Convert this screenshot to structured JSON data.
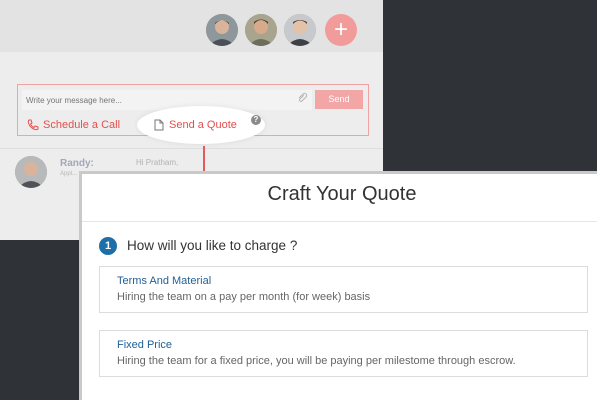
{
  "chat": {
    "message_placeholder": "Write your message here...",
    "send_label": "Send",
    "actions": {
      "schedule_label": "Schedule a Call",
      "quote_label": "Send a Quote",
      "help_label": "?"
    },
    "add_label": "+",
    "last_message": {
      "sender": "Randy:",
      "sub": "Appl...",
      "text": "Hi Pratham,"
    }
  },
  "modal": {
    "title": "Craft Your Quote",
    "step": "1",
    "question": "How will you like to charge ?",
    "options": [
      {
        "title": "Terms And Material",
        "description": "Hiring the team on a pay per month (for week) basis"
      },
      {
        "title": "Fixed Price",
        "description": "Hiring the team for a fixed price, you will be paying per milestome through escrow."
      }
    ]
  },
  "icons": {
    "attach": "paperclip-icon",
    "schedule": "phone-icon",
    "quote": "document-icon",
    "help": "question-icon"
  },
  "colors": {
    "accent_red": "#e1504e",
    "link_blue": "#1f5f99",
    "step_blue": "#1e6fa8",
    "dark_background": "#2f3338"
  }
}
